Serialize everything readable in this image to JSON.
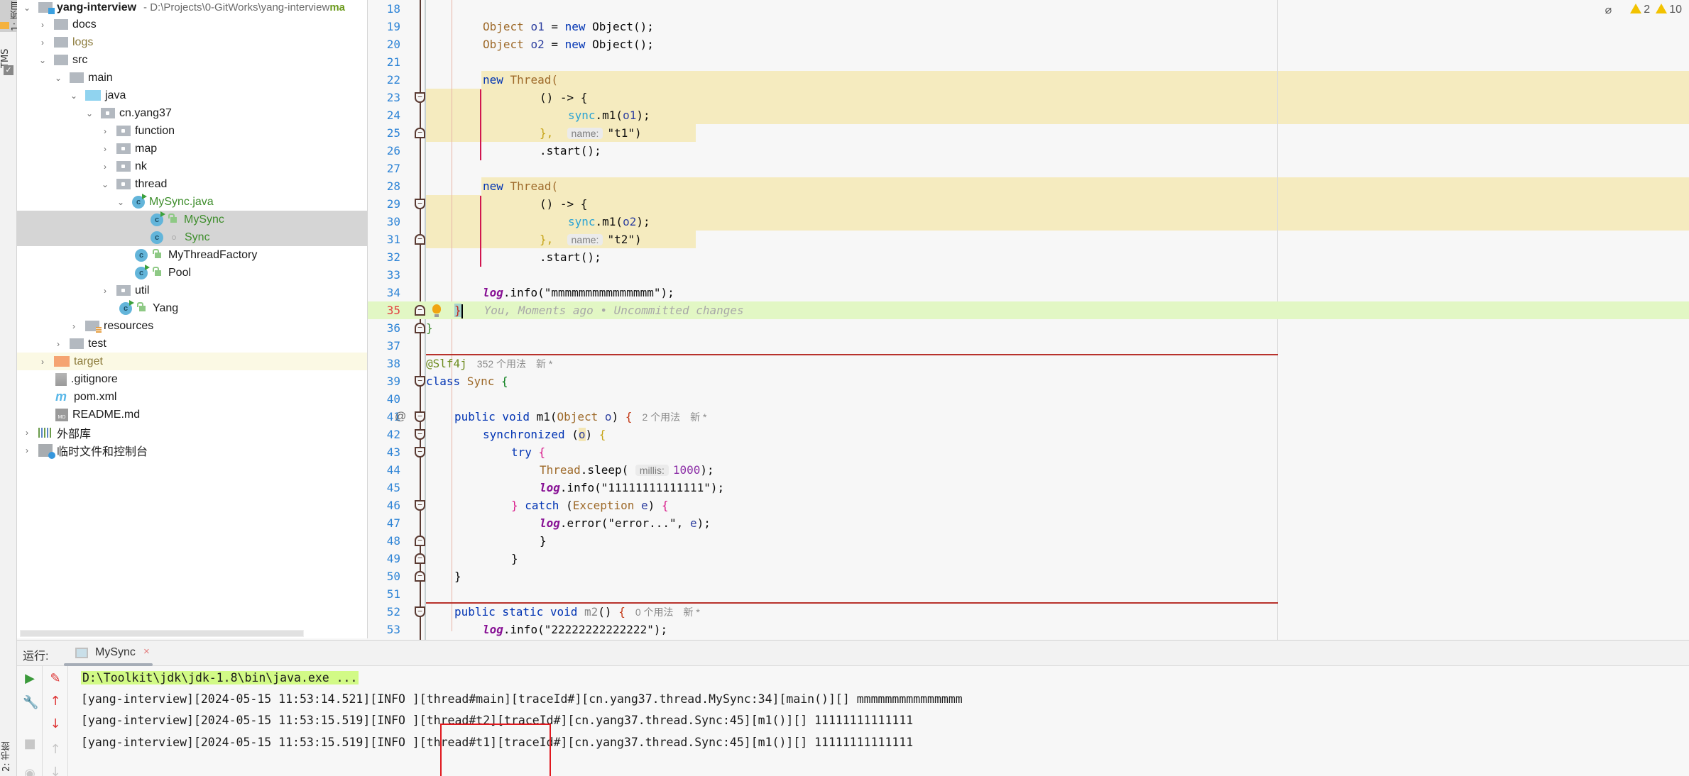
{
  "tool_strip": {
    "project_label": "1: 项目",
    "tms_label": "TMS",
    "bookmarks_label": "2: 书签"
  },
  "project_tree": {
    "root": {
      "name": "yang-interview",
      "path": " - D:\\Projects\\0-GitWorks\\yang-interview",
      "branch": "ma"
    },
    "items": [
      {
        "label": "docs",
        "type": "folder",
        "expanded": false
      },
      {
        "label": "logs",
        "type": "folder",
        "expanded": false
      },
      {
        "label": "src",
        "type": "folder",
        "expanded": true
      },
      {
        "label": "main",
        "type": "folder",
        "expanded": true
      },
      {
        "label": "java",
        "type": "source-folder",
        "expanded": true
      },
      {
        "label": "cn.yang37",
        "type": "package",
        "expanded": true
      },
      {
        "label": "function",
        "type": "package",
        "expanded": false
      },
      {
        "label": "map",
        "type": "package",
        "expanded": false
      },
      {
        "label": "nk",
        "type": "package",
        "expanded": false
      },
      {
        "label": "thread",
        "type": "package",
        "expanded": true
      },
      {
        "label": "MySync.java",
        "type": "java-file",
        "expanded": true
      },
      {
        "label": "MySync",
        "type": "class",
        "selected": true
      },
      {
        "label": "Sync",
        "type": "class",
        "selected": true
      },
      {
        "label": "MyThreadFactory",
        "type": "class"
      },
      {
        "label": "Pool",
        "type": "class"
      },
      {
        "label": "util",
        "type": "package",
        "expanded": false
      },
      {
        "label": "Yang",
        "type": "class"
      },
      {
        "label": "resources",
        "type": "resource-folder",
        "expanded": false
      },
      {
        "label": "test",
        "type": "folder",
        "expanded": false
      },
      {
        "label": "target",
        "type": "excluded-folder",
        "expanded": false
      },
      {
        "label": ".gitignore",
        "type": "file"
      },
      {
        "label": "pom.xml",
        "type": "maven-file"
      },
      {
        "label": "README.md",
        "type": "markdown-file"
      },
      {
        "label": "外部库",
        "type": "external-libraries",
        "expanded": false
      },
      {
        "label": "临时文件和控制台",
        "type": "scratches",
        "expanded": false
      }
    ]
  },
  "editor": {
    "inspections": {
      "warnings_a": "2",
      "warnings_b": "10"
    },
    "lines": {
      "n18": "18",
      "n19": "19",
      "n20": "20",
      "n21": "21",
      "n22": "22",
      "n23": "23",
      "n24": "24",
      "n25": "25",
      "n26": "26",
      "n27": "27",
      "n28": "28",
      "n29": "29",
      "n30": "30",
      "n31": "31",
      "n32": "32",
      "n33": "33",
      "n34": "34",
      "n35": "35",
      "n36": "36",
      "n37": "37",
      "n38": "38",
      "n39": "39",
      "n40": "40",
      "n41": "41",
      "n42": "42",
      "n43": "43",
      "n44": "44",
      "n45": "45",
      "n46": "46",
      "n47": "47",
      "n48": "48",
      "n49": "49",
      "n50": "50",
      "n51": "51",
      "n52": "52",
      "n53": "53"
    },
    "code": {
      "l19": {
        "type": "Object",
        "var": "o1",
        "rest": " = ",
        "kw": "new",
        "call": " Object();"
      },
      "l20": {
        "type": "Object",
        "var": "o2",
        "rest": " = ",
        "kw": "new",
        "call": " Object();"
      },
      "l22": {
        "kw": "new",
        "call": " Thread("
      },
      "l23": {
        "lambda": "() -> {"
      },
      "l24": {
        "field": "sync",
        "call": ".m1(",
        "arg": "o1",
        "end": ");"
      },
      "l25": {
        "brace": "},",
        "hint": "name:",
        "str": "\"t1\"",
        "end": ")"
      },
      "l26": {
        "text": ".start();"
      },
      "l29": {
        "lambda": "() -> {"
      },
      "l30": {
        "field": "sync",
        "call": ".m1(",
        "arg": "o2",
        "end": ");"
      },
      "l31": {
        "brace": "},",
        "hint": "name:",
        "str": "\"t2\"",
        "end": ")"
      },
      "l32": {
        "text": ".start();"
      },
      "l34": {
        "log": "log",
        "call": ".info(",
        "str": "\"mmmmmmmmmmmmmmm\"",
        "end": ");"
      },
      "l35": {
        "brace": "}",
        "blame": "You, Moments ago • Uncommitted changes"
      },
      "l36": {
        "brace": "}"
      },
      "l38": {
        "anno": "@Slf4j",
        "usages": "352 个用法",
        "new": "新 *"
      },
      "l39": {
        "kw": "class",
        "name": " Sync ",
        "brace": "{"
      },
      "l41": {
        "kw": "public void",
        "name": " m1(",
        "type": "Object",
        "param": " o",
        "end": ") ",
        "brace": "{",
        "usages": "2 个用法",
        "new": "新 *"
      },
      "l42": {
        "kw": "synchronized",
        "open": " (",
        "arg": "o",
        "close": ") ",
        "brace": "{"
      },
      "l43": {
        "kw": "try",
        "brace": " {"
      },
      "l44": {
        "type": "Thread",
        "call": ".sleep(",
        "hint": "millis:",
        "num": "1000",
        "end": ");"
      },
      "l45": {
        "log": "log",
        "call": ".info(",
        "str": "\"11111111111111\"",
        "end": ");"
      },
      "l46": {
        "brace": "}",
        "kw": " catch",
        "open": " (",
        "type": "Exception",
        "param": " e",
        "close": ") ",
        "brace2": "{"
      },
      "l47": {
        "log": "log",
        "call": ".error(",
        "str": "\"error...\"",
        "mid": ", ",
        "param": "e",
        "end": ");"
      },
      "l48": {
        "brace": "}"
      },
      "l49": {
        "brace": "}"
      },
      "l50": {
        "brace": "}"
      },
      "l52": {
        "kw": "public static void",
        "name": " m2",
        "paren": "() ",
        "brace": "{",
        "usages": "0 个用法",
        "new": "新 *"
      },
      "l53": {
        "log": "log",
        "call": ".info(",
        "str": "\"22222222222222\"",
        "end": ");"
      }
    }
  },
  "run_panel": {
    "label": "运行:",
    "tab": "MySync",
    "console": [
      "D:\\Toolkit\\jdk\\jdk-1.8\\bin\\java.exe ...",
      "[yang-interview][2024-05-15 11:53:14.521][INFO ][thread#main][traceId#][cn.yang37.thread.MySync:34][main()][] mmmmmmmmmmmmmmm",
      "[yang-interview][2024-05-15 11:53:15.519][INFO ][thread#t2][traceId#][cn.yang37.thread.Sync:45][m1()][] 11111111111111",
      "[yang-interview][2024-05-15 11:53:15.519][INFO ][thread#t1][traceId#][cn.yang37.thread.Sync:45][m1()][] 11111111111111"
    ]
  },
  "colors": {
    "line_number": "#2e84d6",
    "current_line": "#e2f7c4",
    "changed_block": "#f5ebbf",
    "annotation_box": "#e0181e",
    "cmd_highlight": "#d2fa86"
  }
}
